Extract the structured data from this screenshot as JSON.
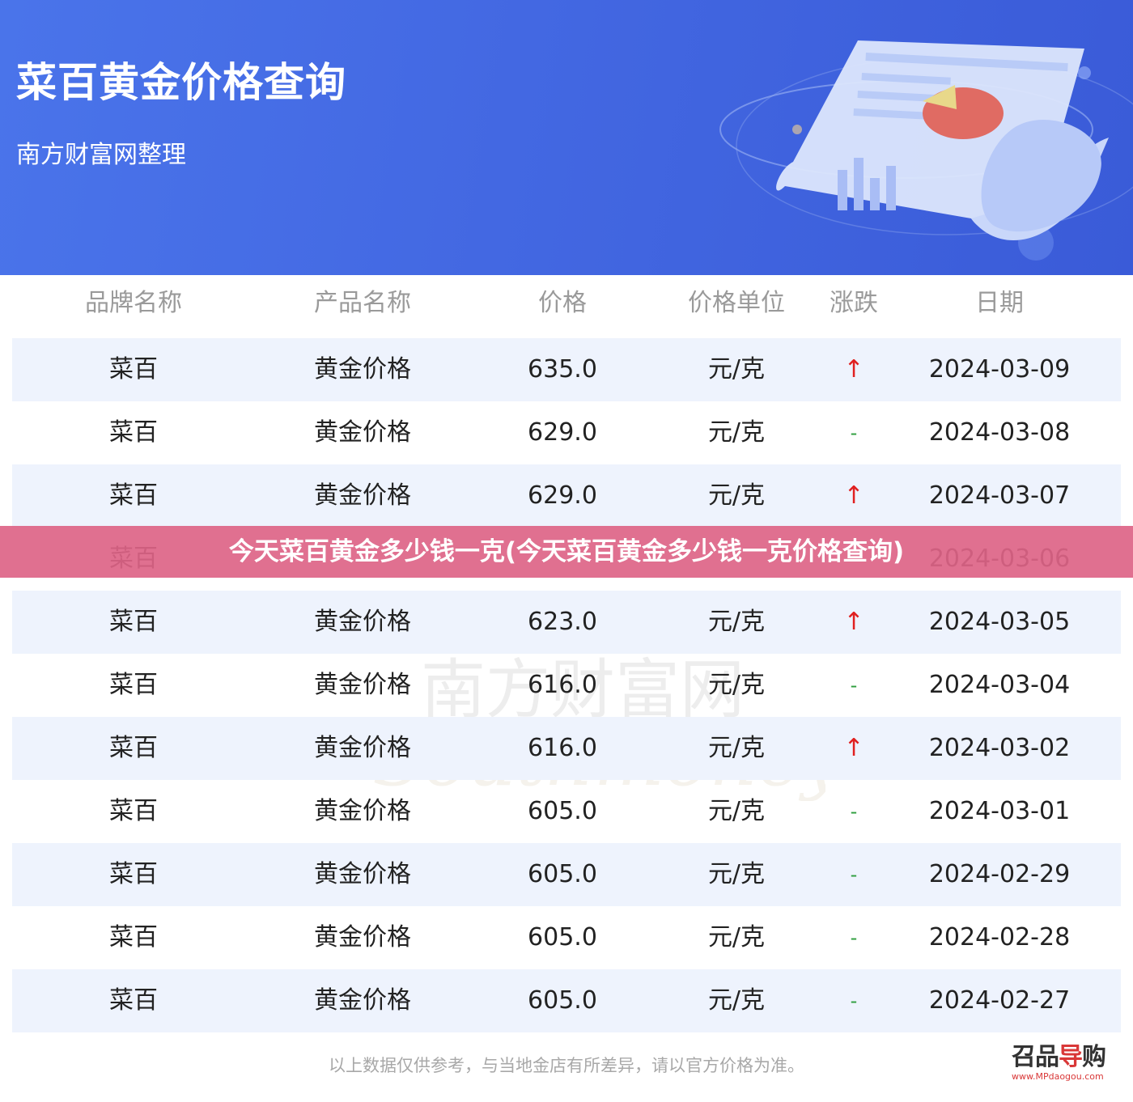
{
  "header": {
    "title": "菜百黄金价格查询",
    "subtitle": "南方财富网整理"
  },
  "table": {
    "columns": [
      "品牌名称",
      "产品名称",
      "价格",
      "价格单位",
      "涨跌",
      "日期"
    ],
    "rows": [
      {
        "brand": "菜百",
        "product": "黄金价格",
        "price": "635.0",
        "unit": "元/克",
        "change": "↑",
        "date": "2024-03-09"
      },
      {
        "brand": "菜百",
        "product": "黄金价格",
        "price": "629.0",
        "unit": "元/克",
        "change": "-",
        "date": "2024-03-08"
      },
      {
        "brand": "菜百",
        "product": "黄金价格",
        "price": "629.0",
        "unit": "元/克",
        "change": "↑",
        "date": "2024-03-07"
      },
      {
        "brand": "菜百",
        "product": "",
        "price": "",
        "unit": "",
        "change": "",
        "date": "2024-03-06"
      },
      {
        "brand": "菜百",
        "product": "黄金价格",
        "price": "623.0",
        "unit": "元/克",
        "change": "↑",
        "date": "2024-03-05"
      },
      {
        "brand": "菜百",
        "product": "黄金价格",
        "price": "616.0",
        "unit": "元/克",
        "change": "-",
        "date": "2024-03-04"
      },
      {
        "brand": "菜百",
        "product": "黄金价格",
        "price": "616.0",
        "unit": "元/克",
        "change": "↑",
        "date": "2024-03-02"
      },
      {
        "brand": "菜百",
        "product": "黄金价格",
        "price": "605.0",
        "unit": "元/克",
        "change": "-",
        "date": "2024-03-01"
      },
      {
        "brand": "菜百",
        "product": "黄金价格",
        "price": "605.0",
        "unit": "元/克",
        "change": "-",
        "date": "2024-02-29"
      },
      {
        "brand": "菜百",
        "product": "黄金价格",
        "price": "605.0",
        "unit": "元/克",
        "change": "-",
        "date": "2024-02-28"
      },
      {
        "brand": "菜百",
        "product": "黄金价格",
        "price": "605.0",
        "unit": "元/克",
        "change": "-",
        "date": "2024-02-27"
      }
    ]
  },
  "banner": {
    "text": "今天菜百黄金多少钱一克(今天菜百黄金多少钱一克价格查询)"
  },
  "watermark": {
    "cn": "南方财富网",
    "en": "Southmoney.com"
  },
  "footer": {
    "disclaimer": "以上数据仅供参考，与当地金店有所差异，请以官方价格为准。"
  },
  "logo": {
    "name_part1": "召品",
    "name_part2": "导",
    "name_part3": "购",
    "url": "www.MPdaogou.com"
  },
  "colors": {
    "header_bg": "#4368e2",
    "row_alt_bg": "#eef3fd",
    "up": "#e02020",
    "flat": "#2e9e3e",
    "banner_bg": "#dd6487"
  }
}
